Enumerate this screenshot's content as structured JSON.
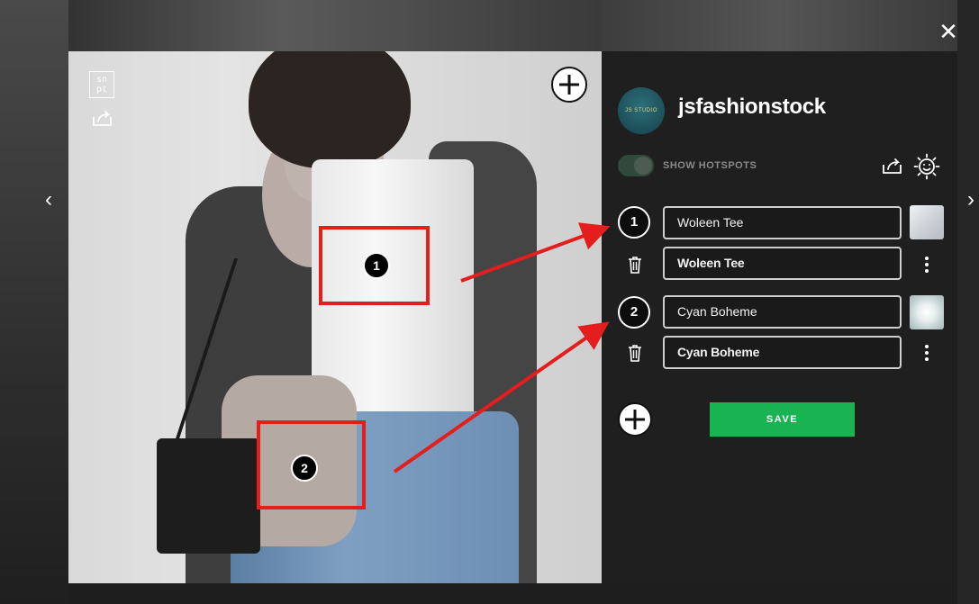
{
  "app": {
    "close_glyph": "✕",
    "nav_prev_glyph": "‹",
    "nav_next_glyph": "›"
  },
  "photo": {
    "logo_text": "sn\npt",
    "share_icon": "share-icon",
    "add_icon": "plus-circle-icon",
    "hotspots": [
      {
        "label": "1"
      },
      {
        "label": "2"
      }
    ]
  },
  "panel": {
    "avatar_text": "JS STUDIO",
    "username": "jsfashionstock",
    "toggle_label": "SHOW HOTSPOTS",
    "toggle_on": true,
    "items": [
      {
        "number": "1",
        "title": "Woleen Tee",
        "product": "Woleen Tee",
        "thumb_color": "#d8dde3"
      },
      {
        "number": "2",
        "title": "Cyan Boheme",
        "product": "Cyan Boheme",
        "thumb_color": "#c9d6d6"
      }
    ],
    "save_label": "SAVE"
  },
  "colors": {
    "accent_green": "#19b352",
    "annotation_red": "#e41d1d",
    "panel_bg": "#1f1f1f"
  }
}
